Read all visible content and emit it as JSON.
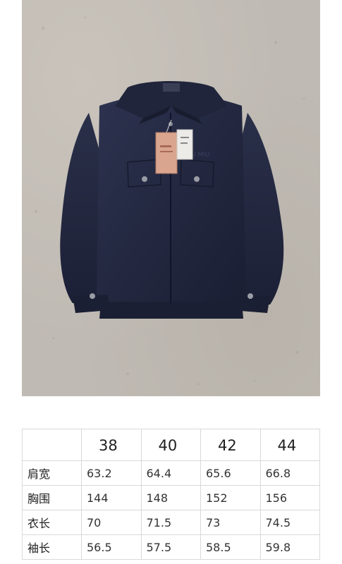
{
  "photo": {
    "subject": "navy-zip-jacket",
    "tag_brand_text": "MIU MIU",
    "background_color": "#bfbab3",
    "jacket_color": "#252a40"
  },
  "size_table": {
    "corner": "",
    "sizes": [
      "38",
      "40",
      "42",
      "44"
    ],
    "rows": [
      {
        "label": "肩宽",
        "values": [
          "63.2",
          "64.4",
          "65.6",
          "66.8"
        ]
      },
      {
        "label": "胸围",
        "values": [
          "144",
          "148",
          "152",
          "156"
        ]
      },
      {
        "label": "衣长",
        "values": [
          "70",
          "71.5",
          "73",
          "74.5"
        ]
      },
      {
        "label": "袖长",
        "values": [
          "56.5",
          "57.5",
          "58.5",
          "59.8"
        ]
      }
    ]
  }
}
